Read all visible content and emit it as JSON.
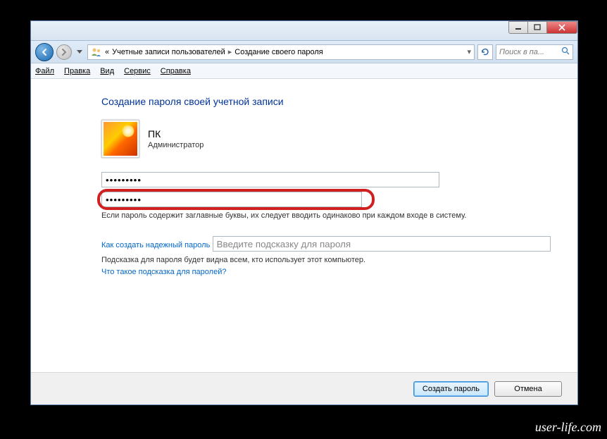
{
  "window": {
    "breadcrumb_prefix": "«",
    "breadcrumb_1": "Учетные записи пользователей",
    "breadcrumb_2": "Создание своего пароля",
    "search_placeholder": "Поиск в па..."
  },
  "menu": {
    "file": "Файл",
    "edit": "Правка",
    "view": "Вид",
    "tools": "Сервис",
    "help": "Справка"
  },
  "page": {
    "title": "Создание пароля своей учетной записи",
    "user_name": "ПК",
    "user_role": "Администратор",
    "password1_value": "•••••••••",
    "password2_value": "•••••••••",
    "case_note": "Если пароль содержит заглавные буквы, их следует вводить одинаково при каждом входе в систему.",
    "link_strong_password": "Как создать надежный пароль",
    "hint_placeholder": "Введите подсказку для пароля",
    "hint_note": "Подсказка для пароля будет видна всем, кто использует этот компьютер.",
    "link_hint_help": "Что такое подсказка для паролей?"
  },
  "buttons": {
    "create": "Создать пароль",
    "cancel": "Отмена"
  },
  "watermark": "user-life.com"
}
